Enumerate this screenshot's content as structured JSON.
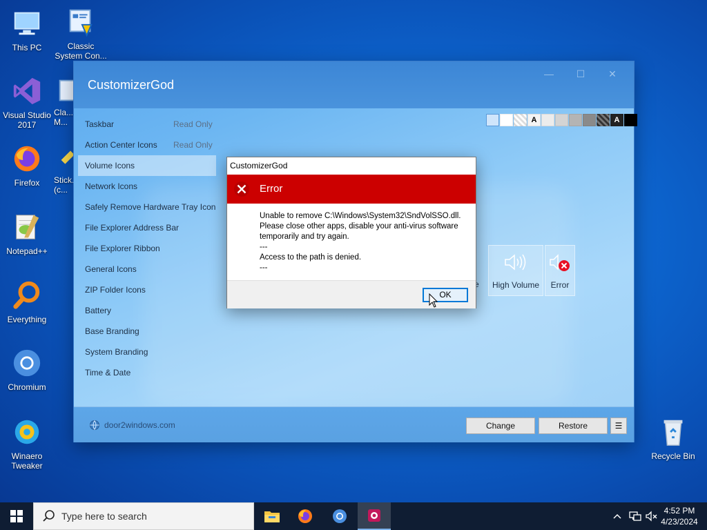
{
  "desktop": {
    "icons": [
      {
        "label": "This PC"
      },
      {
        "label": "Classic System Con..."
      },
      {
        "label": "Visual Studio 2017"
      },
      {
        "label": "Cla... M..."
      },
      {
        "label": "Firefox"
      },
      {
        "label": "Stick... (c..."
      },
      {
        "label": "Notepad++"
      },
      {
        "label": "Everything"
      },
      {
        "label": "Chromium"
      },
      {
        "label": "Winaero Tweaker"
      },
      {
        "label": "Recycle Bin"
      }
    ]
  },
  "window": {
    "title": "CustomizerGod",
    "minimize": "—",
    "maximize": "☐",
    "close": "✕",
    "nav": [
      {
        "label": "Taskbar",
        "tag": "Read Only"
      },
      {
        "label": "Action Center Icons",
        "tag": "Read Only"
      },
      {
        "label": "Volume Icons",
        "tag": ""
      },
      {
        "label": "Network Icons",
        "tag": ""
      },
      {
        "label": "Safely Remove Hardware Tray Icon",
        "tag": ""
      },
      {
        "label": "File Explorer Address Bar",
        "tag": ""
      },
      {
        "label": "File Explorer Ribbon",
        "tag": ""
      },
      {
        "label": "General Icons",
        "tag": ""
      },
      {
        "label": "ZIP Folder Icons",
        "tag": ""
      },
      {
        "label": "Battery",
        "tag": ""
      },
      {
        "label": "Base Branding",
        "tag": ""
      },
      {
        "label": "System Branding",
        "tag": ""
      },
      {
        "label": "Time & Date",
        "tag": ""
      }
    ],
    "swatch_letter": "A",
    "tiles": [
      {
        "label": "e"
      },
      {
        "label": "High Volume"
      },
      {
        "label": "Error"
      }
    ],
    "footer": {
      "link": "door2windows.com",
      "change": "Change",
      "restore": "Restore",
      "menu": "☰"
    }
  },
  "dialog": {
    "title": "CustomizerGod",
    "heading": "Error",
    "lines": [
      "Unable to remove C:\\Windows\\System32\\SndVolSSO.dll.",
      "Please close other apps, disable your anti-virus software",
      "temporarily and try again.",
      "---",
      "Access to the path is denied.",
      "---"
    ],
    "ok": "OK"
  },
  "taskbar": {
    "search_placeholder": "Type here to search",
    "time": "4:52 PM",
    "date": "4/23/2024"
  },
  "colors": {
    "error_red": "#cc0000",
    "accent": "#0078d7",
    "taskbar": "#0f1d33"
  }
}
